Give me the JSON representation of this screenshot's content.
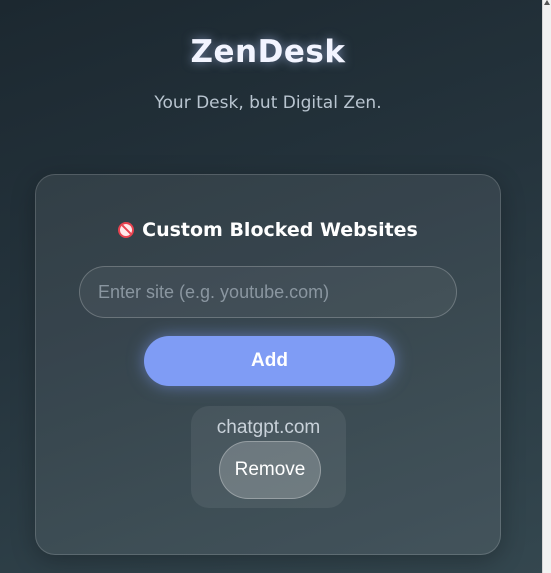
{
  "header": {
    "title": "ZenDesk",
    "subtitle": "Your Desk, but Digital Zen."
  },
  "blocked_sites": {
    "heading_icon": "block-icon",
    "heading": "Custom Blocked Websites",
    "input": {
      "placeholder": "Enter site (e.g. youtube.com)",
      "value": ""
    },
    "add_label": "Add",
    "items": [
      {
        "site": "chatgpt.com",
        "remove_label": "Remove"
      }
    ]
  },
  "colors": {
    "accent": "#7f9cf5",
    "block_icon": "#e8424f"
  }
}
